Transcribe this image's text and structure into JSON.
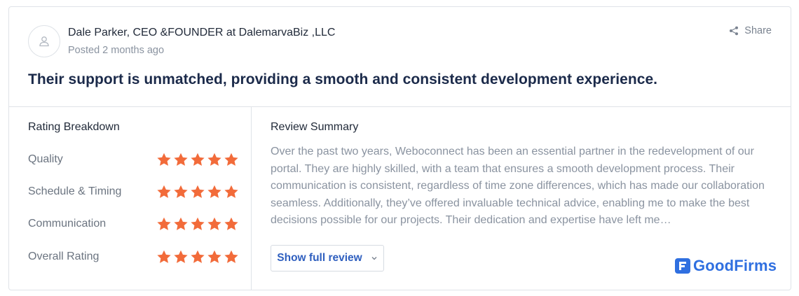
{
  "review": {
    "author": "Dale Parker, CEO &FOUNDER at DalemarvaBiz ,LLC",
    "posted": "Posted 2 months ago",
    "share_label": "Share",
    "headline": "Their support is unmatched, providing a smooth and consistent development experience."
  },
  "breakdown": {
    "title": "Rating Breakdown",
    "items": [
      {
        "label": "Quality",
        "stars": 5
      },
      {
        "label": "Schedule & Timing",
        "stars": 5
      },
      {
        "label": "Communication",
        "stars": 5
      },
      {
        "label": "Overall Rating",
        "stars": 5
      }
    ],
    "star_color": "#f26b3a"
  },
  "summary": {
    "title": "Review Summary",
    "text": "Over the past two years, Weboconnect has been an essential partner in the redevelopment of our portal. They are highly skilled, with a team that ensures a smooth development process. Their communication is consistent, regardless of time zone differences, which has made our collaboration seamless. Additionally, they’ve offered invaluable technical advice, enabling me to make the best decisions possible for our projects. Their dedication and expertise have left me…",
    "button_label": "Show full review"
  },
  "branding": {
    "logo_text": "GoodFirms",
    "accent": "#2f6fe0"
  },
  "icons": [
    "user-icon",
    "share-icon",
    "star-icon",
    "chevron-down-icon",
    "goodfirms-logo-icon"
  ]
}
